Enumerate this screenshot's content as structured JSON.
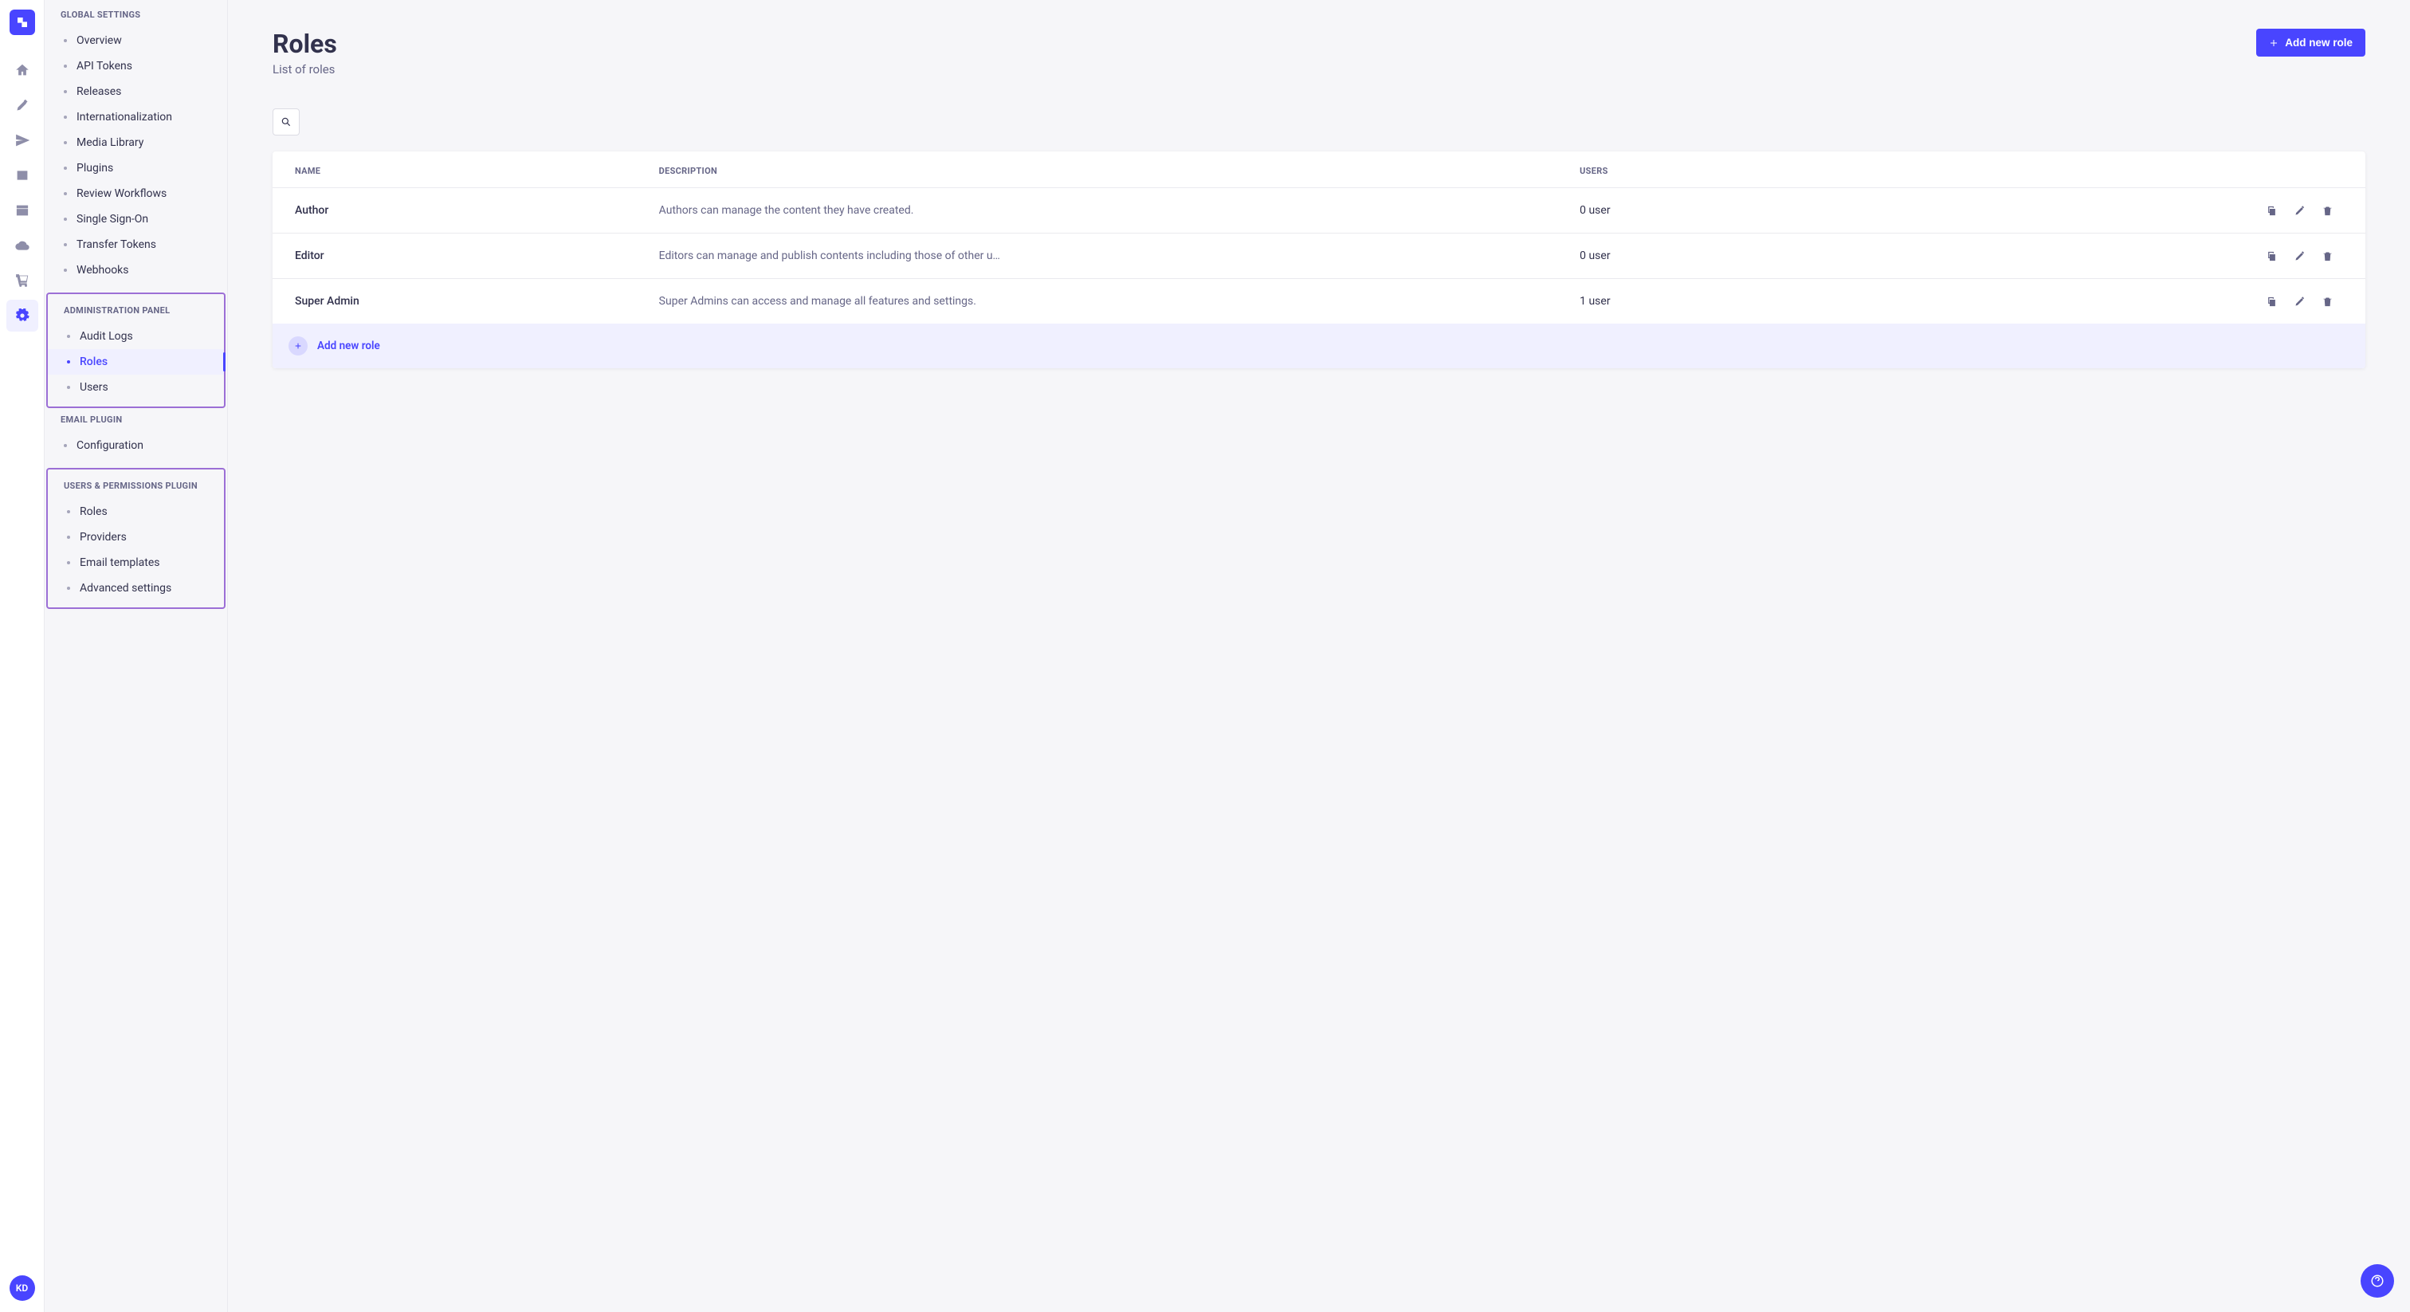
{
  "rail": {
    "avatar_initials": "KD"
  },
  "sidebar": {
    "sections": [
      {
        "title": "GLOBAL SETTINGS",
        "boxed": false,
        "items": [
          {
            "label": "Overview",
            "active": false
          },
          {
            "label": "API Tokens",
            "active": false
          },
          {
            "label": "Releases",
            "active": false
          },
          {
            "label": "Internationalization",
            "active": false
          },
          {
            "label": "Media Library",
            "active": false
          },
          {
            "label": "Plugins",
            "active": false
          },
          {
            "label": "Review Workflows",
            "active": false
          },
          {
            "label": "Single Sign-On",
            "active": false
          },
          {
            "label": "Transfer Tokens",
            "active": false
          },
          {
            "label": "Webhooks",
            "active": false
          }
        ]
      },
      {
        "title": "ADMINISTRATION PANEL",
        "boxed": true,
        "items": [
          {
            "label": "Audit Logs",
            "active": false
          },
          {
            "label": "Roles",
            "active": true
          },
          {
            "label": "Users",
            "active": false
          }
        ]
      },
      {
        "title": "EMAIL PLUGIN",
        "boxed": false,
        "items": [
          {
            "label": "Configuration",
            "active": false
          }
        ]
      },
      {
        "title": "USERS & PERMISSIONS PLUGIN",
        "boxed": true,
        "items": [
          {
            "label": "Roles",
            "active": false
          },
          {
            "label": "Providers",
            "active": false
          },
          {
            "label": "Email templates",
            "active": false
          },
          {
            "label": "Advanced settings",
            "active": false
          }
        ]
      }
    ]
  },
  "main": {
    "title": "Roles",
    "subtitle": "List of roles",
    "add_button_label": "Add new role",
    "table_headers": {
      "name": "NAME",
      "description": "DESCRIPTION",
      "users": "USERS"
    },
    "rows": [
      {
        "name": "Author",
        "description": "Authors can manage the content they have created.",
        "users": "0 user"
      },
      {
        "name": "Editor",
        "description": "Editors can manage and publish contents including those of other u…",
        "users": "0 user"
      },
      {
        "name": "Super Admin",
        "description": "Super Admins can access and manage all features and settings.",
        "users": "1 user"
      }
    ],
    "add_row_label": "Add new role"
  }
}
